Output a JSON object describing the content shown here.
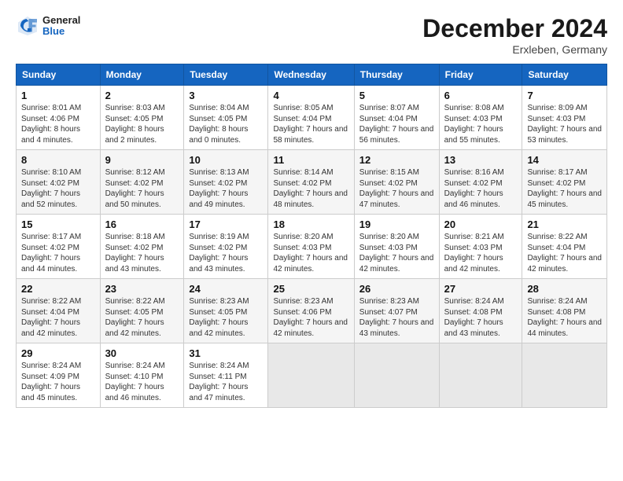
{
  "header": {
    "logo_general": "General",
    "logo_blue": "Blue",
    "month": "December 2024",
    "location": "Erxleben, Germany"
  },
  "days_of_week": [
    "Sunday",
    "Monday",
    "Tuesday",
    "Wednesday",
    "Thursday",
    "Friday",
    "Saturday"
  ],
  "weeks": [
    [
      {
        "day": "1",
        "sunrise": "Sunrise: 8:01 AM",
        "sunset": "Sunset: 4:06 PM",
        "daylight": "Daylight: 8 hours and 4 minutes."
      },
      {
        "day": "2",
        "sunrise": "Sunrise: 8:03 AM",
        "sunset": "Sunset: 4:05 PM",
        "daylight": "Daylight: 8 hours and 2 minutes."
      },
      {
        "day": "3",
        "sunrise": "Sunrise: 8:04 AM",
        "sunset": "Sunset: 4:05 PM",
        "daylight": "Daylight: 8 hours and 0 minutes."
      },
      {
        "day": "4",
        "sunrise": "Sunrise: 8:05 AM",
        "sunset": "Sunset: 4:04 PM",
        "daylight": "Daylight: 7 hours and 58 minutes."
      },
      {
        "day": "5",
        "sunrise": "Sunrise: 8:07 AM",
        "sunset": "Sunset: 4:04 PM",
        "daylight": "Daylight: 7 hours and 56 minutes."
      },
      {
        "day": "6",
        "sunrise": "Sunrise: 8:08 AM",
        "sunset": "Sunset: 4:03 PM",
        "daylight": "Daylight: 7 hours and 55 minutes."
      },
      {
        "day": "7",
        "sunrise": "Sunrise: 8:09 AM",
        "sunset": "Sunset: 4:03 PM",
        "daylight": "Daylight: 7 hours and 53 minutes."
      }
    ],
    [
      {
        "day": "8",
        "sunrise": "Sunrise: 8:10 AM",
        "sunset": "Sunset: 4:02 PM",
        "daylight": "Daylight: 7 hours and 52 minutes."
      },
      {
        "day": "9",
        "sunrise": "Sunrise: 8:12 AM",
        "sunset": "Sunset: 4:02 PM",
        "daylight": "Daylight: 7 hours and 50 minutes."
      },
      {
        "day": "10",
        "sunrise": "Sunrise: 8:13 AM",
        "sunset": "Sunset: 4:02 PM",
        "daylight": "Daylight: 7 hours and 49 minutes."
      },
      {
        "day": "11",
        "sunrise": "Sunrise: 8:14 AM",
        "sunset": "Sunset: 4:02 PM",
        "daylight": "Daylight: 7 hours and 48 minutes."
      },
      {
        "day": "12",
        "sunrise": "Sunrise: 8:15 AM",
        "sunset": "Sunset: 4:02 PM",
        "daylight": "Daylight: 7 hours and 47 minutes."
      },
      {
        "day": "13",
        "sunrise": "Sunrise: 8:16 AM",
        "sunset": "Sunset: 4:02 PM",
        "daylight": "Daylight: 7 hours and 46 minutes."
      },
      {
        "day": "14",
        "sunrise": "Sunrise: 8:17 AM",
        "sunset": "Sunset: 4:02 PM",
        "daylight": "Daylight: 7 hours and 45 minutes."
      }
    ],
    [
      {
        "day": "15",
        "sunrise": "Sunrise: 8:17 AM",
        "sunset": "Sunset: 4:02 PM",
        "daylight": "Daylight: 7 hours and 44 minutes."
      },
      {
        "day": "16",
        "sunrise": "Sunrise: 8:18 AM",
        "sunset": "Sunset: 4:02 PM",
        "daylight": "Daylight: 7 hours and 43 minutes."
      },
      {
        "day": "17",
        "sunrise": "Sunrise: 8:19 AM",
        "sunset": "Sunset: 4:02 PM",
        "daylight": "Daylight: 7 hours and 43 minutes."
      },
      {
        "day": "18",
        "sunrise": "Sunrise: 8:20 AM",
        "sunset": "Sunset: 4:03 PM",
        "daylight": "Daylight: 7 hours and 42 minutes."
      },
      {
        "day": "19",
        "sunrise": "Sunrise: 8:20 AM",
        "sunset": "Sunset: 4:03 PM",
        "daylight": "Daylight: 7 hours and 42 minutes."
      },
      {
        "day": "20",
        "sunrise": "Sunrise: 8:21 AM",
        "sunset": "Sunset: 4:03 PM",
        "daylight": "Daylight: 7 hours and 42 minutes."
      },
      {
        "day": "21",
        "sunrise": "Sunrise: 8:22 AM",
        "sunset": "Sunset: 4:04 PM",
        "daylight": "Daylight: 7 hours and 42 minutes."
      }
    ],
    [
      {
        "day": "22",
        "sunrise": "Sunrise: 8:22 AM",
        "sunset": "Sunset: 4:04 PM",
        "daylight": "Daylight: 7 hours and 42 minutes."
      },
      {
        "day": "23",
        "sunrise": "Sunrise: 8:22 AM",
        "sunset": "Sunset: 4:05 PM",
        "daylight": "Daylight: 7 hours and 42 minutes."
      },
      {
        "day": "24",
        "sunrise": "Sunrise: 8:23 AM",
        "sunset": "Sunset: 4:05 PM",
        "daylight": "Daylight: 7 hours and 42 minutes."
      },
      {
        "day": "25",
        "sunrise": "Sunrise: 8:23 AM",
        "sunset": "Sunset: 4:06 PM",
        "daylight": "Daylight: 7 hours and 42 minutes."
      },
      {
        "day": "26",
        "sunrise": "Sunrise: 8:23 AM",
        "sunset": "Sunset: 4:07 PM",
        "daylight": "Daylight: 7 hours and 43 minutes."
      },
      {
        "day": "27",
        "sunrise": "Sunrise: 8:24 AM",
        "sunset": "Sunset: 4:08 PM",
        "daylight": "Daylight: 7 hours and 43 minutes."
      },
      {
        "day": "28",
        "sunrise": "Sunrise: 8:24 AM",
        "sunset": "Sunset: 4:08 PM",
        "daylight": "Daylight: 7 hours and 44 minutes."
      }
    ],
    [
      {
        "day": "29",
        "sunrise": "Sunrise: 8:24 AM",
        "sunset": "Sunset: 4:09 PM",
        "daylight": "Daylight: 7 hours and 45 minutes."
      },
      {
        "day": "30",
        "sunrise": "Sunrise: 8:24 AM",
        "sunset": "Sunset: 4:10 PM",
        "daylight": "Daylight: 7 hours and 46 minutes."
      },
      {
        "day": "31",
        "sunrise": "Sunrise: 8:24 AM",
        "sunset": "Sunset: 4:11 PM",
        "daylight": "Daylight: 7 hours and 47 minutes."
      },
      null,
      null,
      null,
      null
    ]
  ]
}
